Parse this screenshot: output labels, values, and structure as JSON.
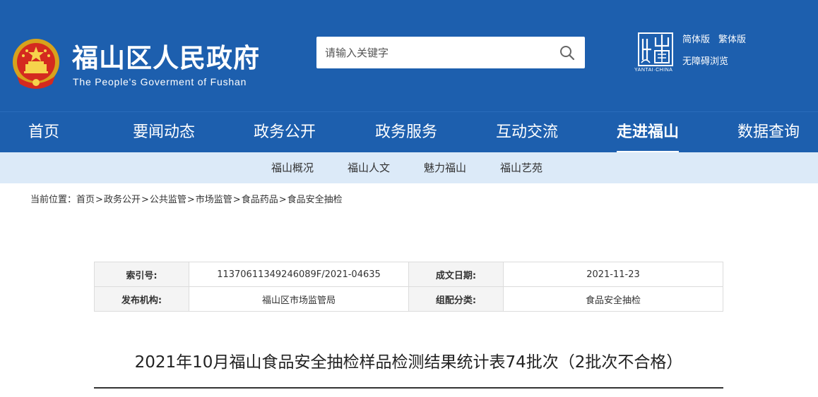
{
  "header": {
    "title": "福山区人民政府",
    "subtitle": "The People's Goverment of Fushan",
    "emblem_icon": "national-emblem-icon",
    "search": {
      "placeholder": "请输入关键字",
      "icon": "search-icon"
    },
    "yantai_logo_text": "YANTAI·CHINA",
    "lang_simplified": "简体版",
    "lang_traditional": "繁体版",
    "accessibility": "无障碍浏览"
  },
  "nav": {
    "items": [
      {
        "label": "首页"
      },
      {
        "label": "要闻动态"
      },
      {
        "label": "政务公开"
      },
      {
        "label": "政务服务"
      },
      {
        "label": "互动交流"
      },
      {
        "label": "走进福山",
        "active": true
      },
      {
        "label": "数据查询"
      }
    ]
  },
  "subnav": {
    "items": [
      {
        "label": "福山概况"
      },
      {
        "label": "福山人文"
      },
      {
        "label": "魅力福山"
      },
      {
        "label": "福山艺苑"
      }
    ]
  },
  "breadcrumb": {
    "prefix": "当前位置：",
    "items": [
      "首页",
      "政务公开",
      "公共监管",
      "市场监管",
      "食品药品",
      "食品安全抽检"
    ],
    "separator": ">"
  },
  "info": {
    "index_label": "索引号:",
    "index_value": "11370611349246089F/2021-04635",
    "date_label": "成文日期:",
    "date_value": "2021-11-23",
    "publisher_label": "发布机构:",
    "publisher_value": "福山区市场监管局",
    "category_label": "组配分类:",
    "category_value": "食品安全抽检"
  },
  "article": {
    "title": "2021年10月福山食品安全抽检样品检测结果统计表74批次（2批次不合格）"
  },
  "colors": {
    "header_blue": "#1d5fae",
    "subnav_bg": "#dceaf8"
  }
}
